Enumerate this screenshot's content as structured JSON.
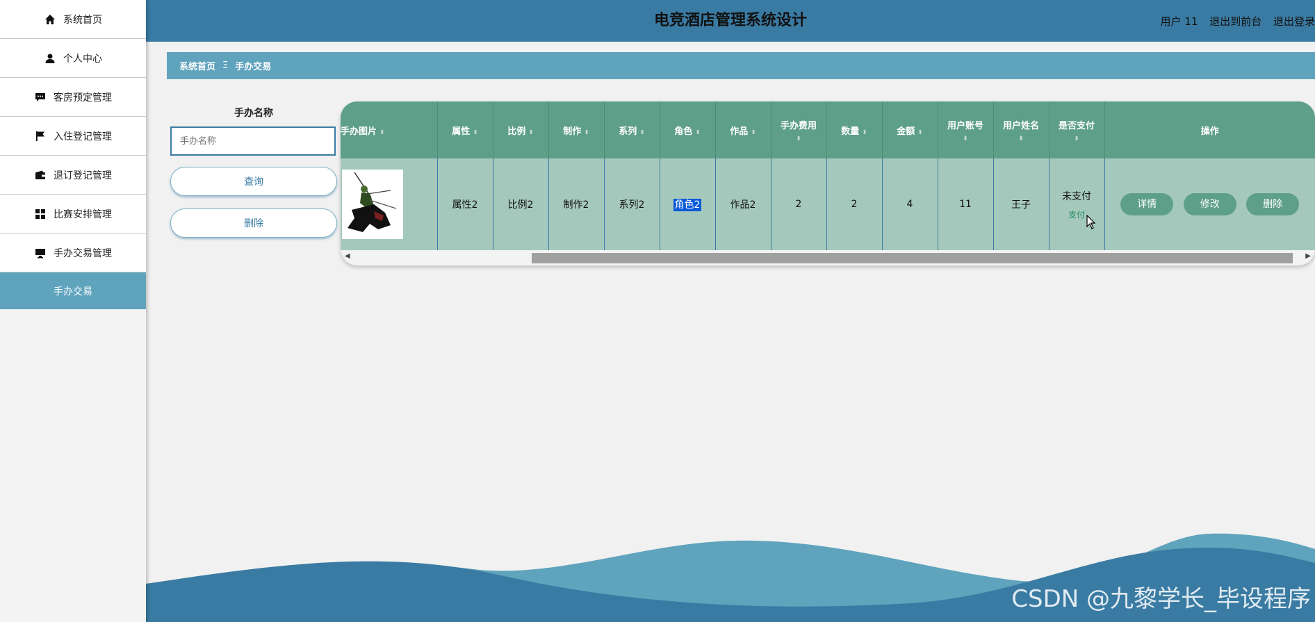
{
  "header": {
    "title": "电竞酒店管理系统设计",
    "user": "用户 11",
    "back_to_front": "退出到前台",
    "logout": "退出登录"
  },
  "sidebar": {
    "items": [
      {
        "label": "系统首页",
        "icon": "home-icon"
      },
      {
        "label": "个人中心",
        "icon": "user-icon"
      },
      {
        "label": "客房预定管理",
        "icon": "chat-icon"
      },
      {
        "label": "入住登记管理",
        "icon": "flag-icon"
      },
      {
        "label": "退订登记管理",
        "icon": "wallet-icon"
      },
      {
        "label": "比赛安排管理",
        "icon": "grid-icon"
      },
      {
        "label": "手办交易管理",
        "icon": "monitor-icon"
      }
    ],
    "sub_item": "手办交易"
  },
  "breadcrumb": {
    "home": "系统首页",
    "sep": "Ξ",
    "current": "手办交易"
  },
  "search": {
    "label": "手办名称",
    "placeholder": "手办名称",
    "query_button": "查询",
    "delete_button": "删除"
  },
  "table": {
    "headers": {
      "image": "手办图片",
      "attr": "属性",
      "scale": "比例",
      "maker": "制作",
      "series": "系列",
      "role": "角色",
      "work": "作品",
      "fee": "手办费用",
      "qty": "数量",
      "amount": "金额",
      "account": "用户账号",
      "name": "用户姓名",
      "paid": "是否支付",
      "ops": "操作"
    },
    "row": {
      "attr": "属性2",
      "scale": "比例2",
      "maker": "制作2",
      "series": "系列2",
      "role": "角色2",
      "work": "作品2",
      "fee": "2",
      "qty": "2",
      "amount": "4",
      "account": "11",
      "name": "王子",
      "paid": "未支付",
      "pay_link": "支付"
    },
    "actions": {
      "detail": "详情",
      "edit": "修改",
      "delete": "删除"
    }
  },
  "watermark": "CSDN @九黎学长_毕设程序",
  "colors": {
    "header": "#3a7ba3",
    "accent": "#5fa3bd",
    "table_header": "#5e9f8a",
    "table_row": "#a5c8bd"
  }
}
